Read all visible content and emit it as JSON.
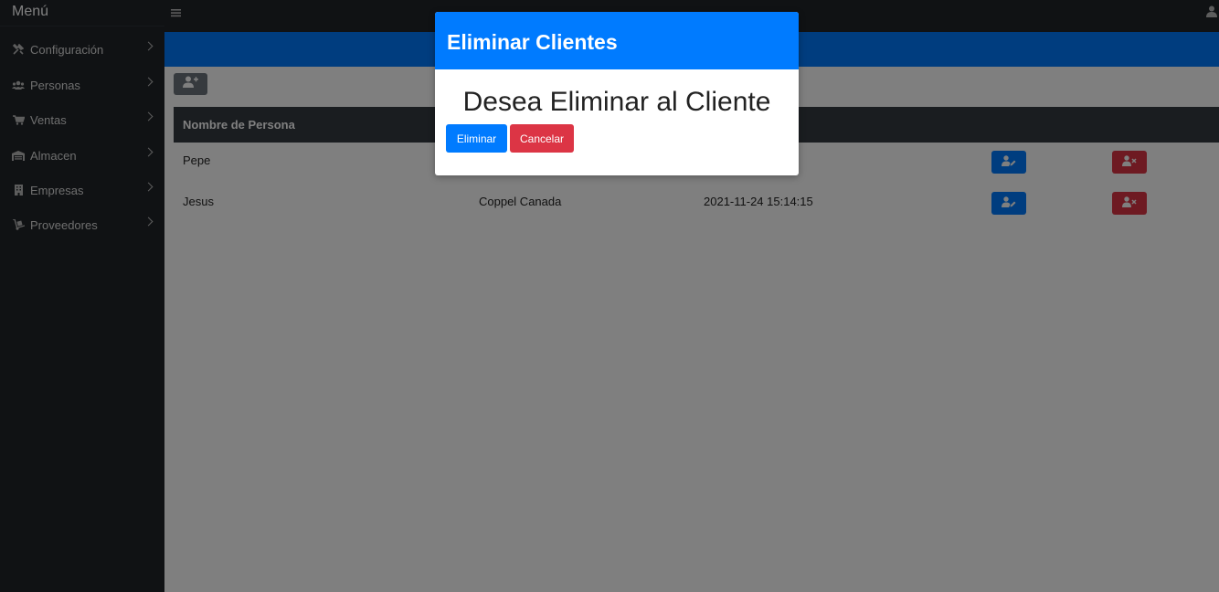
{
  "sidebar": {
    "title": "Menú",
    "items": [
      {
        "label": "Configuración",
        "icon": "tools-icon"
      },
      {
        "label": "Personas",
        "icon": "users-icon"
      },
      {
        "label": "Ventas",
        "icon": "cart-icon"
      },
      {
        "label": "Almacen",
        "icon": "warehouse-icon"
      },
      {
        "label": "Empresas",
        "icon": "building-icon"
      },
      {
        "label": "Proveedores",
        "icon": "dolly-icon"
      }
    ]
  },
  "table": {
    "headers": [
      "Nombre de Persona"
    ],
    "rows": [
      {
        "name": "Pepe",
        "company": "",
        "date": "07"
      },
      {
        "name": "Jesus",
        "company": "Coppel Canada",
        "date": "2021-11-24 15:14:15"
      }
    ]
  },
  "modal": {
    "title": "Eliminar Clientes",
    "message": "Desea Eliminar al Cliente",
    "confirm_label": "Eliminar",
    "cancel_label": "Cancelar"
  },
  "colors": {
    "primary": "#007bff",
    "danger": "#dc3545",
    "dark": "#212529",
    "secondary": "#6c757d"
  }
}
